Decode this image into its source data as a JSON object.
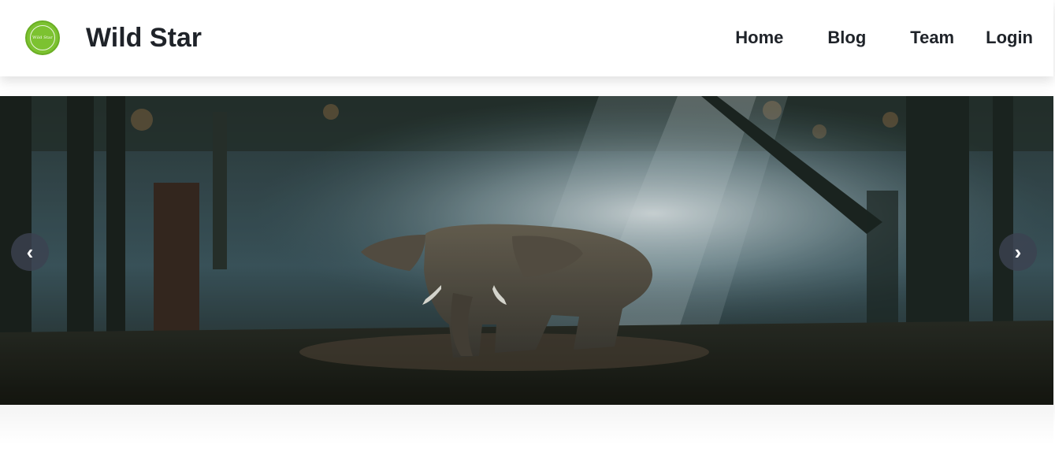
{
  "brand": {
    "name": "Wild Star",
    "logo_text": "Wild Star",
    "logo_color": "#7cc230"
  },
  "nav": {
    "links": [
      {
        "label": "Home"
      },
      {
        "label": "Blog"
      },
      {
        "label": "Team"
      },
      {
        "label": "Login"
      }
    ]
  },
  "carousel": {
    "slide": {
      "image": "elephant in misty forest"
    },
    "prev_icon": "chevron-left-icon",
    "next_icon": "chevron-right-icon",
    "prev_glyph": "‹",
    "next_glyph": "›"
  }
}
